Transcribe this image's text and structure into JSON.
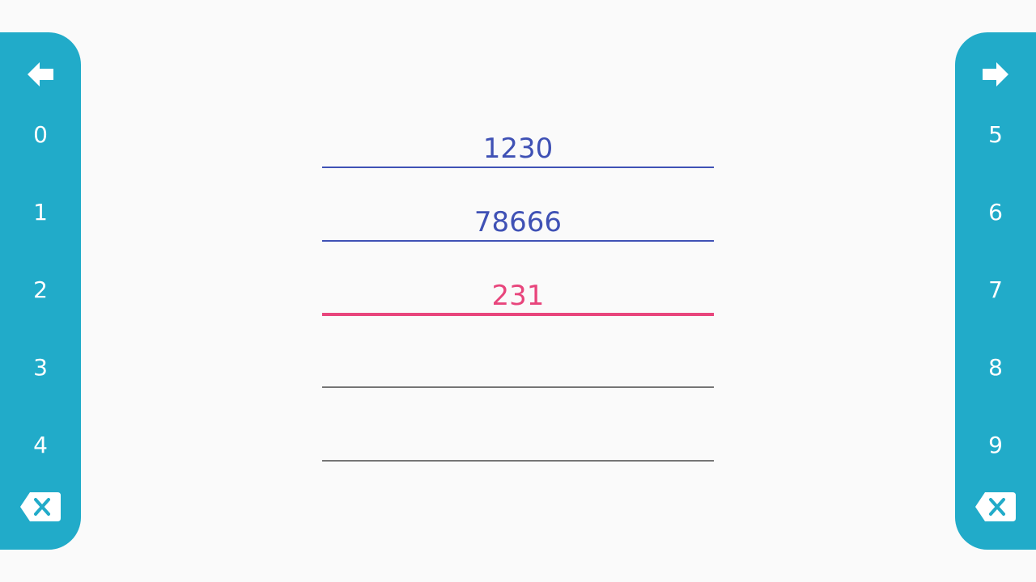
{
  "colors": {
    "panel": "#21abc9",
    "key_text": "#ffffff",
    "filled_value": "#3f51b5",
    "active_value": "#e8457c",
    "empty_line": "#757575",
    "background": "#fafafa"
  },
  "left_keypad": {
    "back_icon": "arrow-left-icon",
    "keys": [
      "0",
      "1",
      "2",
      "3",
      "4"
    ],
    "delete_icon": "backspace-icon"
  },
  "right_keypad": {
    "forward_icon": "arrow-right-icon",
    "keys": [
      "5",
      "6",
      "7",
      "8",
      "9"
    ],
    "delete_icon": "backspace-icon"
  },
  "fields": [
    {
      "value": "1230",
      "state": "filled"
    },
    {
      "value": "78666",
      "state": "filled"
    },
    {
      "value": "231",
      "state": "active"
    },
    {
      "value": "",
      "state": "empty"
    },
    {
      "value": "",
      "state": "empty"
    }
  ]
}
